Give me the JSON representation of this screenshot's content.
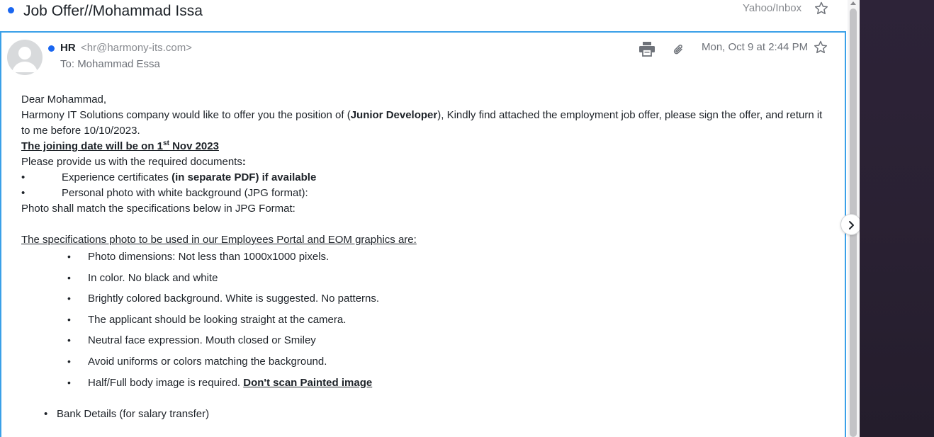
{
  "header": {
    "subject": "Job Offer//Mohammad Issa",
    "folder": "Yahoo/Inbox"
  },
  "message": {
    "sender_name": "HR",
    "sender_email": "<hr@harmony-its.com>",
    "to_label": "To:",
    "to_name": "Mohammad Essa",
    "date": "Mon, Oct 9 at 2:44 PM"
  },
  "body": {
    "greeting": "Dear Mohammad,",
    "intro_pre": "Harmony IT Solutions company would like to offer you the position of (",
    "intro_role": "Junior Developer",
    "intro_post": "), Kindly find attached the employment job offer, please sign the offer, and return it to me before 10/10/2023.",
    "joining_pre": "The joining date will be on 1",
    "joining_sup": "st",
    "joining_post": " Nov 2023",
    "provide": "Please provide us with the required documents",
    "provide_colon": ":",
    "doc1_pre": "Experience certificates ",
    "doc1_bold": "(in separate PDF) if available",
    "doc2": "Personal photo with white background (JPG format):",
    "bullet_char": "•",
    "photo_note": "Photo shall match the specifications below in JPG Format:",
    "spec_heading": "The specifications photo to be used in our Employees Portal and EOM graphics are:",
    "specs": [
      "Photo dimensions: Not less than 1000x1000 pixels.",
      "In color. No black and white",
      "Brightly colored background. White is suggested. No patterns.",
      "The applicant should be looking straight at the camera.",
      "Neutral face expression. Mouth closed or Smiley",
      "Avoid uniforms or colors matching the background.",
      "Half/Full body image is required. "
    ],
    "spec_last_bold": "Don't scan  Painted image",
    "bank": "Bank Details (for salary transfer)"
  }
}
